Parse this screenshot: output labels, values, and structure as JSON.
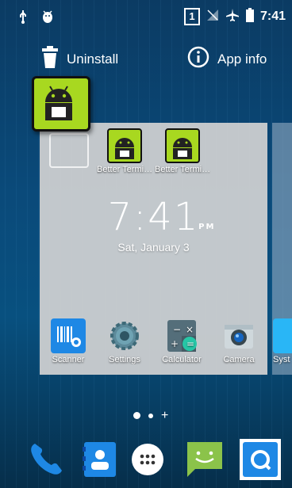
{
  "status_bar": {
    "icons": [
      "usb-icon",
      "android-debug-icon",
      "sim-icon",
      "no-signal-icon",
      "airplane-mode-icon",
      "battery-icon"
    ],
    "sim_number": "1",
    "time": "7:41"
  },
  "drop_targets": {
    "uninstall_label": "Uninstall",
    "app_info_label": "App info"
  },
  "workspace": {
    "shortcuts": [
      {
        "label": "Better Termi…",
        "icon": "terminal-android-icon"
      },
      {
        "label": "Better Termi…",
        "icon": "terminal-android-icon"
      }
    ],
    "clock": {
      "time": "7:41",
      "ampm": "PM",
      "date": "Sat, January 3"
    },
    "hotseat_apps": [
      {
        "label": "Scanner",
        "icon": "barcode-scanner-icon"
      },
      {
        "label": "Settings",
        "icon": "gear-icon"
      },
      {
        "label": "Calculator",
        "icon": "calculator-icon"
      },
      {
        "label": "Camera",
        "icon": "camera-icon"
      },
      {
        "label": "Syst",
        "icon": "system-icon"
      }
    ]
  },
  "page_indicator": {
    "plus": "+"
  },
  "dock": [
    {
      "name": "Phone",
      "icon": "phone-icon"
    },
    {
      "name": "Contacts",
      "icon": "contacts-icon"
    },
    {
      "name": "All apps",
      "icon": "app-drawer-icon"
    },
    {
      "name": "Messaging",
      "icon": "messaging-icon"
    },
    {
      "name": "Browser",
      "icon": "search-browser-icon"
    }
  ],
  "colors": {
    "android_green": "#a8d820",
    "phone_blue": "#1e88e5",
    "messaging_green": "#8bc34a"
  }
}
